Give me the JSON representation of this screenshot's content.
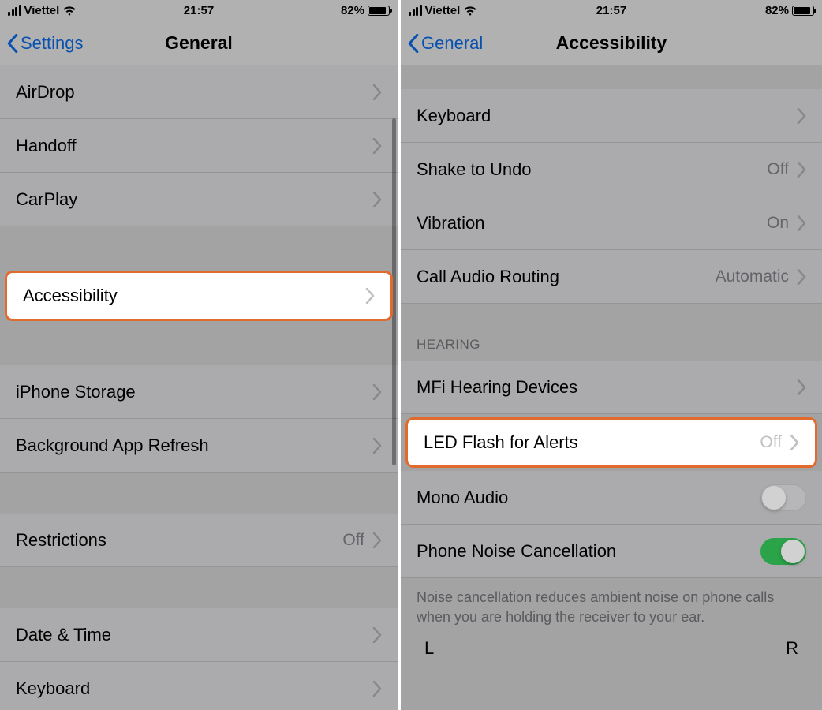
{
  "statusbar": {
    "carrier": "Viettel",
    "time": "21:57",
    "battery_pct": "82%"
  },
  "left": {
    "back_label": "Settings",
    "title": "General",
    "rows": {
      "airdrop": "AirDrop",
      "handoff": "Handoff",
      "carplay": "CarPlay",
      "accessibility": "Accessibility",
      "iphone_storage": "iPhone Storage",
      "bg_refresh": "Background App Refresh",
      "restrictions": "Restrictions",
      "restrictions_val": "Off",
      "date_time": "Date & Time",
      "keyboard": "Keyboard"
    }
  },
  "right": {
    "back_label": "General",
    "title": "Accessibility",
    "rows": {
      "keyboard": "Keyboard",
      "shake_undo": "Shake to Undo",
      "shake_undo_val": "Off",
      "vibration": "Vibration",
      "vibration_val": "On",
      "call_audio": "Call Audio Routing",
      "call_audio_val": "Automatic",
      "hearing_header": "HEARING",
      "mfi": "MFi Hearing Devices",
      "led_flash": "LED Flash for Alerts",
      "led_flash_val": "Off",
      "mono_audio": "Mono Audio",
      "noise_cancel": "Phone Noise Cancellation",
      "footer": "Noise cancellation reduces ambient noise on phone calls when you are holding the receiver to your ear.",
      "balance_l": "L",
      "balance_r": "R"
    }
  }
}
